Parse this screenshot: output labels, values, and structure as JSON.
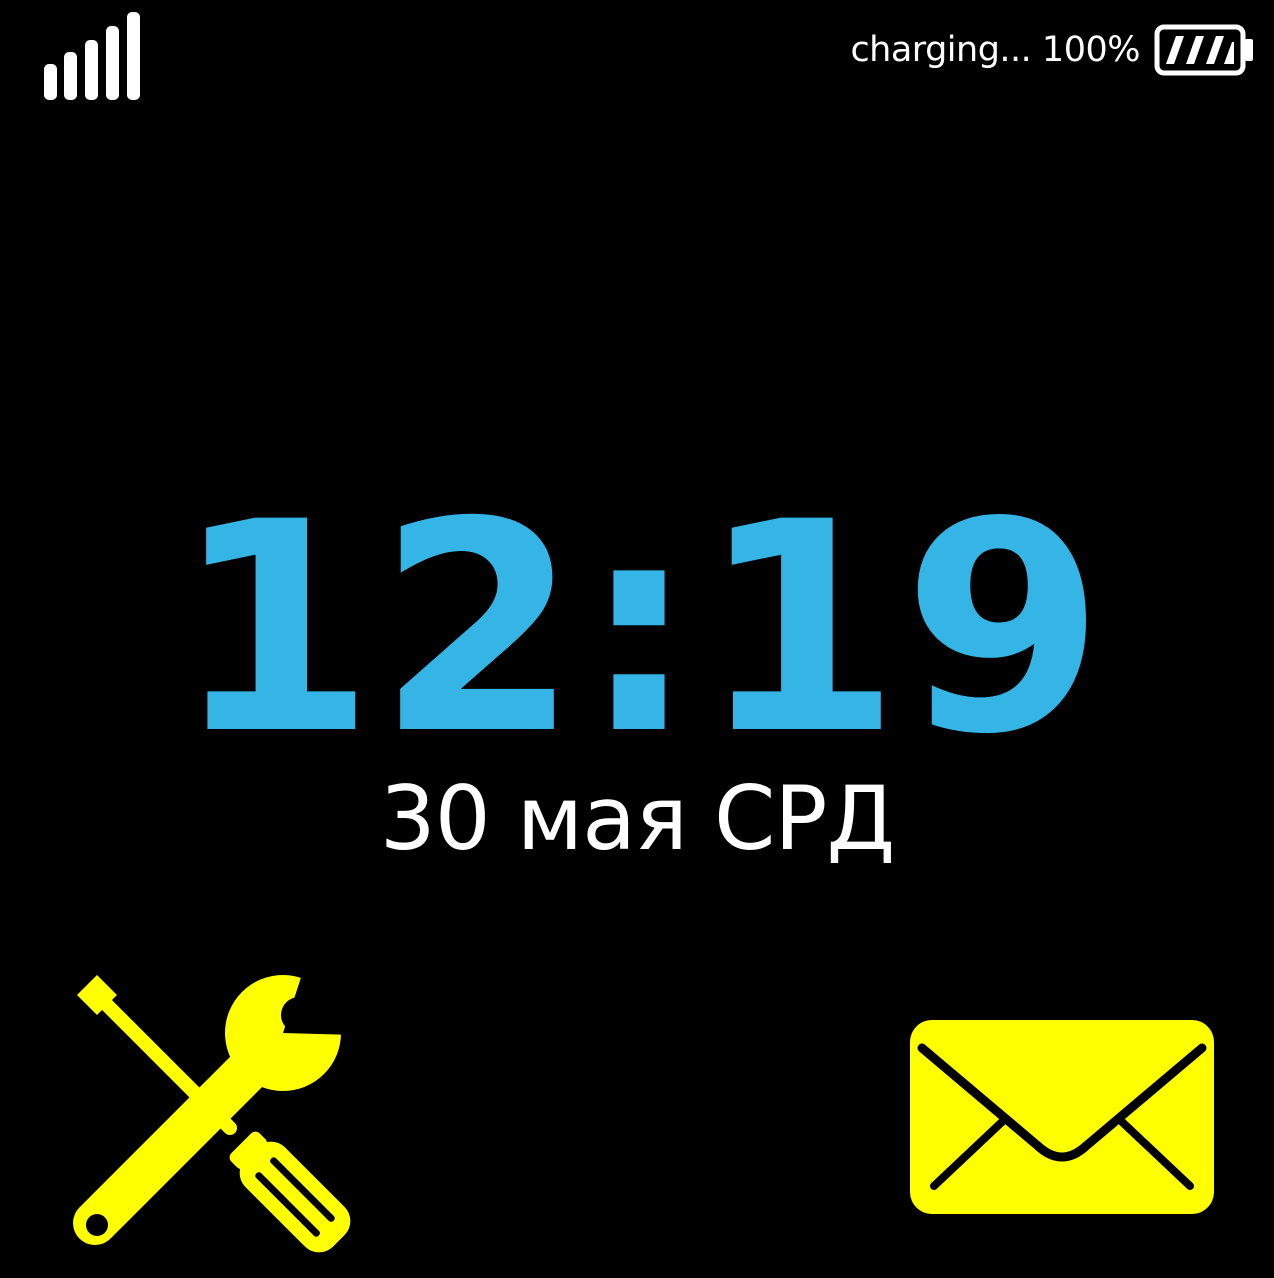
{
  "status_bar": {
    "signal_icon": "signal-strength-icon",
    "signal_bars_filled": 5,
    "signal_bars_total": 5,
    "charging_label": "charging... 100%",
    "battery_icon": "battery-charging-icon",
    "battery_level": 1.0
  },
  "clock": {
    "time": "12:19",
    "date": "30 мая СРД"
  },
  "softkeys": {
    "left_icon": "tools-icon",
    "right_icon": "envelope-icon"
  },
  "colors": {
    "background": "#000000",
    "clock": "#35b5e5",
    "text": "#ffffff",
    "softkey_accent": "#ffff00"
  }
}
